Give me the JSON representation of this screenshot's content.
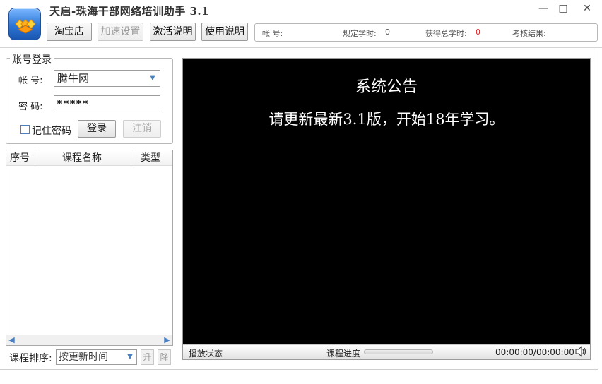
{
  "app": {
    "title": "天启-珠海干部网络培训助手  3.1",
    "window_controls": {
      "minimize": "—",
      "maximize": "□",
      "close": "✕"
    }
  },
  "toolbar": {
    "taobao": "淘宝店",
    "speed": "加速设置",
    "activate": "激活说明",
    "help": "使用说明"
  },
  "status": {
    "account_label": "帐 号:",
    "account_value": "",
    "required_hours_label": "规定学时:",
    "required_hours_value": "0",
    "earned_hours_label": "获得总学时:",
    "earned_hours_value": "0",
    "result_label": "考核结果:",
    "result_value": ""
  },
  "login": {
    "group_title": "账号登录",
    "account_label": "帐  号:",
    "account_value": "腾牛网",
    "password_label": "密  码:",
    "password_value": "*****",
    "remember_label": "记住密码",
    "remember_checked": false,
    "login_button": "登录",
    "logout_button": "注销"
  },
  "course_list": {
    "columns": [
      "序号",
      "课程名称",
      "类型"
    ],
    "rows": []
  },
  "sort": {
    "label": "课程排序:",
    "selected": "按更新时间",
    "up_button": "升",
    "down_button": "降"
  },
  "player": {
    "notice_title": "系统公告",
    "notice_body": "请更新最新3.1版，开始18年学习。",
    "play_status_label": "播放状态",
    "progress_label": "课程进度",
    "progress_fraction": 0,
    "time_display": "00:00:00/00:00:00"
  },
  "colors": {
    "accent_blue": "#4a7fc0",
    "player_background": "#000000",
    "earned_hours_color": "#e02020"
  },
  "icons": {
    "logo": "app-logo-icon",
    "combo_arrow": "chevron-down-icon",
    "volume": "speaker-icon"
  }
}
